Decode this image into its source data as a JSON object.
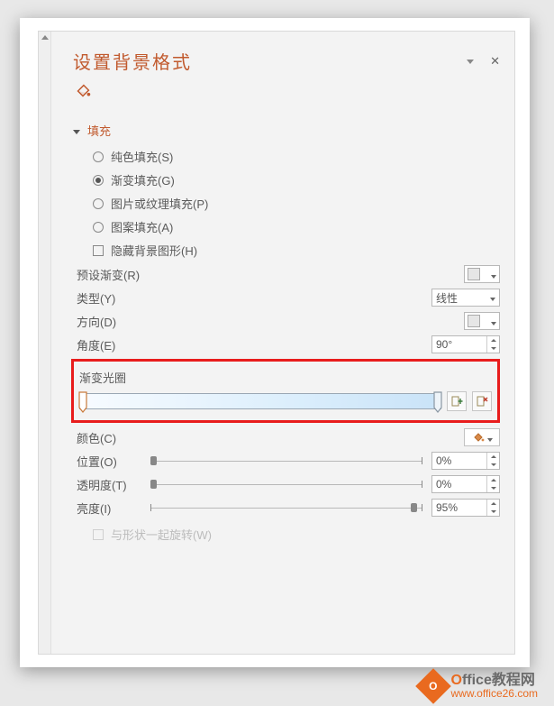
{
  "panel": {
    "title": "设置背景格式"
  },
  "section": {
    "fill": "填充"
  },
  "fillOptions": {
    "solid": "纯色填充(S)",
    "gradient": "渐变填充(G)",
    "pictureTexture": "图片或纹理填充(P)",
    "pattern": "图案填充(A)",
    "hideBg": "隐藏背景图形(H)"
  },
  "labels": {
    "preset": "预设渐变(R)",
    "type": "类型(Y)",
    "direction": "方向(D)",
    "angle": "角度(E)",
    "stops": "渐变光圈",
    "color": "颜色(C)",
    "position": "位置(O)",
    "transparency": "透明度(T)",
    "brightness": "亮度(I)",
    "rotateWithShape": "与形状一起旋转(W)"
  },
  "values": {
    "type": "线性",
    "angle": "90°",
    "position": "0%",
    "transparency": "0%",
    "brightness": "95%"
  },
  "watermark": {
    "brand_prefix": "O",
    "brand_rest": "ffice教程网",
    "url": "www.office26.com"
  }
}
